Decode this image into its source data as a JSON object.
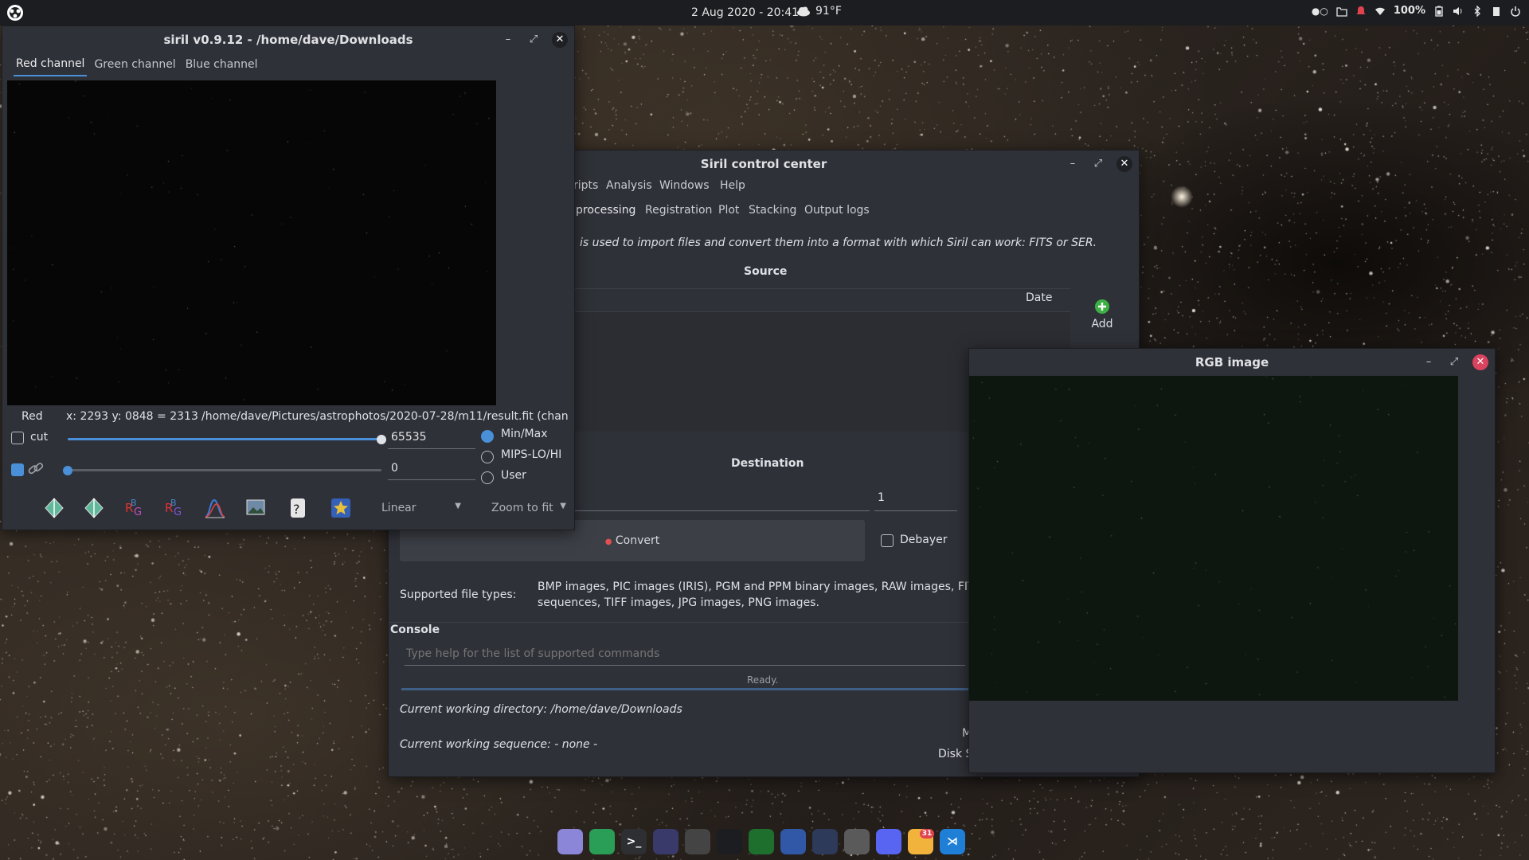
{
  "top_panel": {
    "datetime": "2 Aug 2020 - 20:41",
    "temperature": "91°F",
    "battery": "100%",
    "icons": [
      "distro-logo-icon",
      "weather-cloud-icon",
      "folder-icon",
      "notification-bell-icon",
      "wifi-icon",
      "battery-icon",
      "volume-icon",
      "bluetooth-icon",
      "clipboard-icon",
      "power-icon"
    ]
  },
  "siril_window": {
    "title": "siril v0.9.12 - /home/dave/Downloads",
    "tabs": [
      "Red channel",
      "Green channel",
      "Blue channel"
    ],
    "active_tab": "Red channel",
    "status": {
      "channel": "Red",
      "coords": "x: 2293 y: 0848 = 2313",
      "path": "/home/dave/Pictures/astrophotos/2020-07-28/m11/result.fit (chan"
    },
    "cut_label": "cut",
    "high_value": "65535",
    "low_value": "0",
    "high_slider_fraction": 1.0,
    "low_slider_fraction": 0.0,
    "scale_options": [
      "Min/Max",
      "MIPS-LO/HI",
      "User"
    ],
    "scale_selected": "Min/Max",
    "display_mode": "Linear",
    "zoom": "Zoom to fit",
    "toolbar_icons": [
      "auto-stretch-icon",
      "histogram-stretch-icon",
      "rgb-align-icon",
      "rgb-mirror-icon",
      "histogram-icon",
      "image-gallery-icon",
      "photometry-icon",
      "star-icon"
    ]
  },
  "control_center": {
    "title": "Siril control center",
    "menu": [
      "ripts",
      "Analysis",
      "Windows",
      "Help"
    ],
    "tabs": [
      "processing",
      "Registration",
      "Plot",
      "Stacking",
      "Output logs"
    ],
    "description": "is used to import files and convert them into a format with which Siril can work: FITS or SER.",
    "source_heading": "Source",
    "date_column": "Date",
    "add_label": "Add",
    "destination_heading": "Destination",
    "destination_index": "1",
    "convert_label": "Convert",
    "debayer_label": "Debayer",
    "supported_label": "Supported file types:",
    "supported_line1": "BMP images, PIC images (IRIS), PGM and PPM binary images, RAW images, FIT",
    "supported_line2": "sequences, TIFF images, JPG images, PNG images.",
    "console_heading": "Console",
    "console_placeholder": "Type help for the list of supported commands",
    "ready_text": "Ready.",
    "cwd": "Current working directory: /home/dave/Downloads",
    "cws": "Current working sequence: - none -",
    "disk_label": "Disk S",
    "mem_label": "M"
  },
  "rgb_window": {
    "title": "RGB image"
  },
  "dock": {
    "apps": [
      "files-icon",
      "chrome-icon",
      "terminal-icon",
      "stellarium-icon",
      "inkscape-icon",
      "telescope-icon",
      "spotify-icon",
      "kstars-icon",
      "virtualbox-icon",
      "calculator-icon",
      "discord-icon",
      "mail-icon",
      "vscode-icon"
    ],
    "mail_badge": "31"
  },
  "colors": {
    "accent": "#4a90d9",
    "window_bg": "#2f3138",
    "close_red": "#d9435e",
    "add_green": "#3cb043"
  }
}
